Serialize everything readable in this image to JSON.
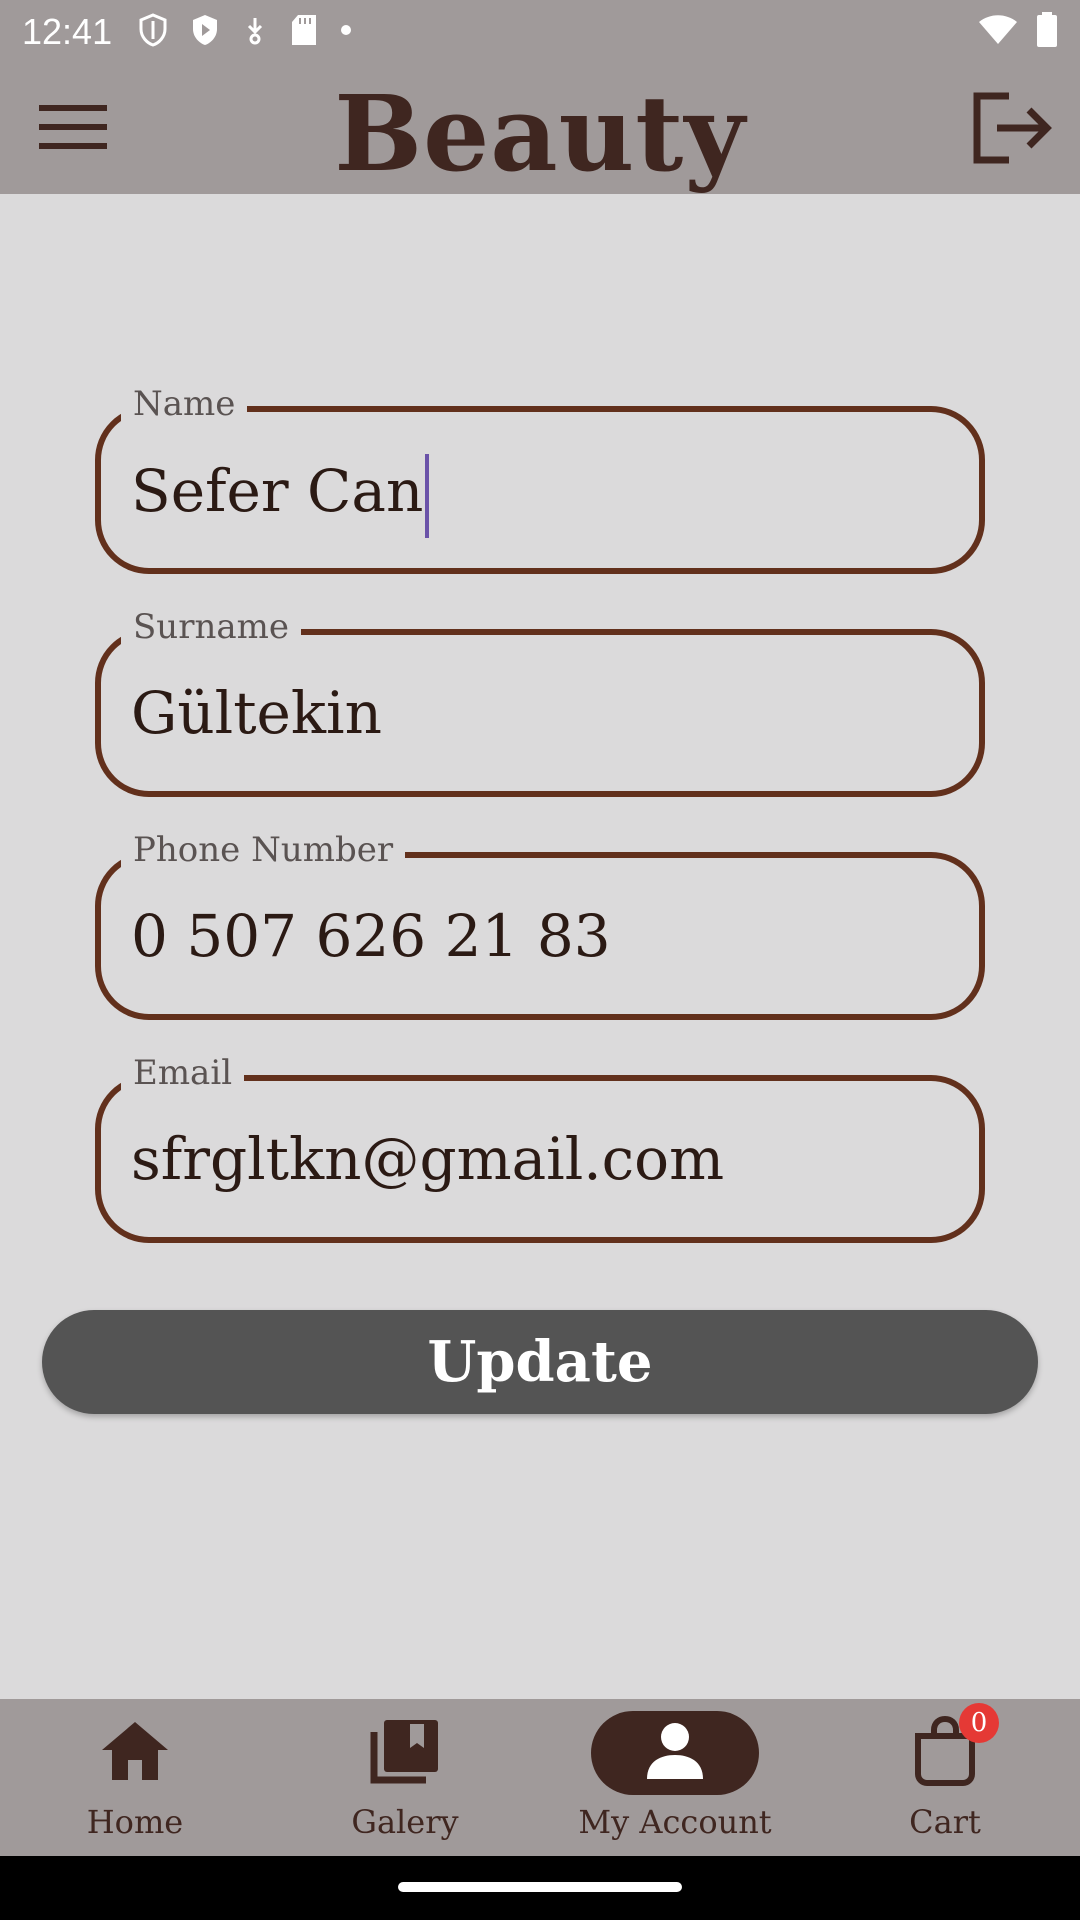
{
  "status_bar": {
    "time": "12:41",
    "icons": [
      "shield-outline-icon",
      "shield-play-icon",
      "download-icon",
      "sd-card-icon",
      "dot-icon"
    ],
    "right_icons": [
      "wifi-icon",
      "battery-icon"
    ]
  },
  "app_bar": {
    "title": "Beauty",
    "menu_icon": "menu-icon",
    "logout_icon": "logout-icon"
  },
  "form": {
    "name": {
      "label": "Name",
      "value": "Sefer Can",
      "focused": true
    },
    "surname": {
      "label": "Surname",
      "value": "Gültekin"
    },
    "phone": {
      "label": "Phone Number",
      "value": "0 507 626 21 83"
    },
    "email": {
      "label": "Email",
      "value": "sfrgltkn@gmail.com"
    },
    "update_label": "Update"
  },
  "bottom_nav": {
    "items": [
      {
        "label": "Home",
        "icon": "home-icon",
        "active": false
      },
      {
        "label": "Galery",
        "icon": "gallery-icon",
        "active": false
      },
      {
        "label": "My Account",
        "icon": "person-icon",
        "active": true
      },
      {
        "label": "Cart",
        "icon": "shopping-bag-icon",
        "active": false,
        "badge": "0"
      }
    ]
  },
  "colors": {
    "bar_background": "#a09a9a",
    "page_background": "#dbdadb",
    "field_border": "#62301c",
    "accent_dark": "#3f2620",
    "button_background": "#545454",
    "badge": "#e53935",
    "caret": "#6a52a8"
  }
}
